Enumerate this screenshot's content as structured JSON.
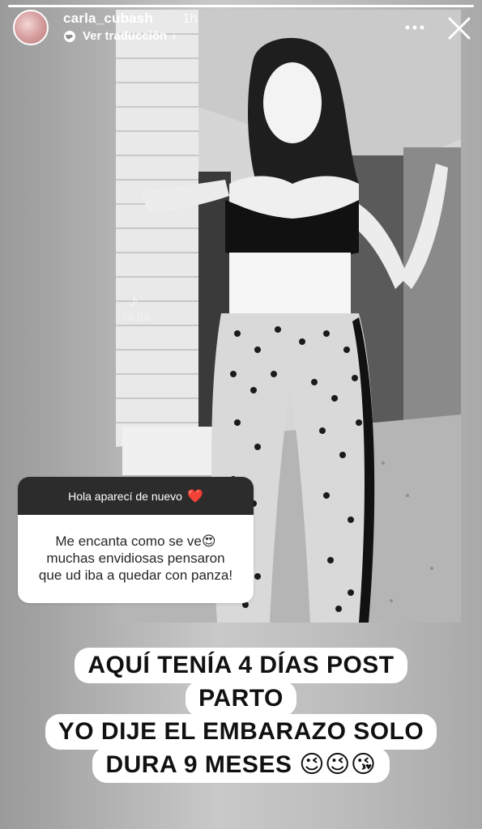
{
  "story": {
    "progress": 1.0,
    "username": "carla_cubash",
    "time": "1h",
    "translate_label": "Ver traducción",
    "icons": {
      "avatar": "profile-avatar",
      "translate": "globe-icon",
      "more": "more-horizontal-icon",
      "close": "close-icon"
    }
  },
  "media": {
    "watermark": "TikTok"
  },
  "question_sticker": {
    "question": "Hola aparecí de nuevo",
    "question_emoji": "❤️",
    "answer_lines": [
      "Me encanta como se ve😍",
      "muchas envidiosas pensaron",
      "que ud iba a quedar con panza!"
    ]
  },
  "caption": {
    "lines": [
      "AQUÍ TENÍA 4 DÍAS POST",
      "PARTO",
      "YO DIJE EL EMBARAZO SOLO",
      "DURA 9 MESES 😉😉😘"
    ]
  },
  "colors": {
    "sticker_header": "#2c2c2c",
    "heart": "#e0222e",
    "text_light": "#ffffff"
  }
}
